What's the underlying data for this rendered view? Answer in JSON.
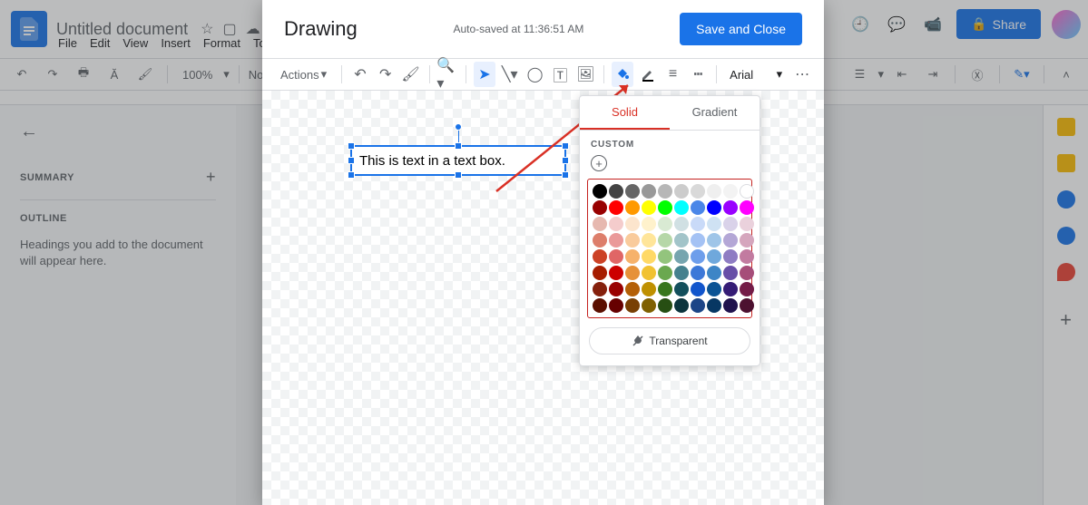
{
  "doc": {
    "title": "Untitled document"
  },
  "menus": [
    "File",
    "Edit",
    "View",
    "Insert",
    "Format",
    "Tools"
  ],
  "toolbar": {
    "zoom": "100%",
    "style": "Normal text"
  },
  "share": {
    "label": "Share"
  },
  "sidebar": {
    "summary": "SUMMARY",
    "outline": "OUTLINE",
    "hint": "Headings you add to the document will appear here."
  },
  "drawing": {
    "title": "Drawing",
    "autosave": "Auto-saved at 11:36:51 AM",
    "save_close": "Save and Close",
    "actions": "Actions",
    "font": "Arial",
    "text_content": "This is text in a text box."
  },
  "colorpicker": {
    "tab_solid": "Solid",
    "tab_gradient": "Gradient",
    "custom": "CUSTOM",
    "transparent": "Transparent",
    "swatches": [
      [
        "#000000",
        "#434343",
        "#666666",
        "#999999",
        "#b7b7b7",
        "#cccccc",
        "#d9d9d9",
        "#efefef",
        "#f3f3f3",
        "#ffffff"
      ],
      [
        "#980000",
        "#ff0000",
        "#ff9900",
        "#ffff00",
        "#00ff00",
        "#00ffff",
        "#4a86e8",
        "#0000ff",
        "#9900ff",
        "#ff00ff"
      ],
      [
        "#e6b8af",
        "#f4cccc",
        "#fce5cd",
        "#fff2cc",
        "#d9ead3",
        "#d0e0e3",
        "#c9daf8",
        "#cfe2f3",
        "#d9d2e9",
        "#ead1dc"
      ],
      [
        "#dd7e6b",
        "#ea9999",
        "#f9cb9c",
        "#ffe599",
        "#b6d7a8",
        "#a2c4c9",
        "#a4c2f4",
        "#9fc5e8",
        "#b4a7d6",
        "#d5a6bd"
      ],
      [
        "#cc4125",
        "#e06666",
        "#f6b26b",
        "#ffd966",
        "#93c47d",
        "#76a5af",
        "#6d9eeb",
        "#6fa8dc",
        "#8e7cc3",
        "#c27ba0"
      ],
      [
        "#a61c00",
        "#cc0000",
        "#e69138",
        "#f1c232",
        "#6aa84f",
        "#45818e",
        "#3c78d8",
        "#3d85c6",
        "#674ea7",
        "#a64d79"
      ],
      [
        "#85200c",
        "#990000",
        "#b45f06",
        "#bf9000",
        "#38761d",
        "#134f5c",
        "#1155cc",
        "#0b5394",
        "#351c75",
        "#741b47"
      ],
      [
        "#5b0f00",
        "#660000",
        "#783f04",
        "#7f6000",
        "#274e13",
        "#0c343d",
        "#1c4587",
        "#073763",
        "#20124d",
        "#4c1130"
      ]
    ]
  }
}
